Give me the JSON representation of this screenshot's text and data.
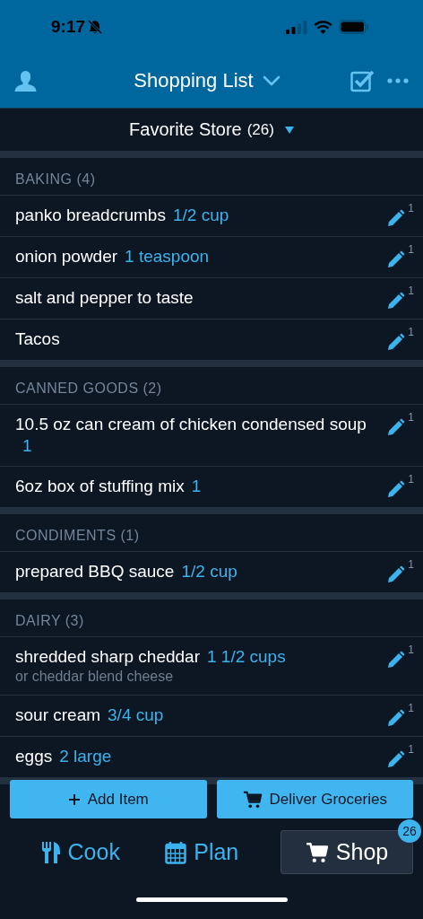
{
  "status_bar": {
    "time": "9:17"
  },
  "header": {
    "title": "Shopping List"
  },
  "store_bar": {
    "name": "Favorite Store",
    "count": "(26)"
  },
  "sections": [
    {
      "title": "BAKING (4)",
      "items": [
        {
          "name": "panko breadcrumbs",
          "amount": "1/2 cup",
          "count": "1"
        },
        {
          "name": "onion powder",
          "amount": "1 teaspoon",
          "count": "1"
        },
        {
          "name": "salt and pepper to taste",
          "count": "1"
        },
        {
          "name": "Tacos",
          "count": "1"
        }
      ]
    },
    {
      "title": "CANNED GOODS (2)",
      "items": [
        {
          "name": "10.5 oz can cream of chicken condensed soup",
          "amount": "1",
          "count": "1"
        },
        {
          "name": "6oz box of stuffing mix",
          "amount": "1",
          "count": "1"
        }
      ]
    },
    {
      "title": "CONDIMENTS (1)",
      "items": [
        {
          "name": "prepared BBQ sauce",
          "amount": "1/2 cup",
          "count": "1"
        }
      ]
    },
    {
      "title": "DAIRY (3)",
      "items": [
        {
          "name": "shredded sharp cheddar",
          "amount": "1 1/2 cups",
          "note": "or cheddar blend cheese",
          "count": "1"
        },
        {
          "name": "sour cream",
          "amount": "3/4 cup",
          "count": "1"
        },
        {
          "name": "eggs",
          "amount": "2 large",
          "count": "1"
        }
      ]
    }
  ],
  "actions": [
    {
      "kind": "add",
      "label": "Add Item"
    },
    {
      "kind": "deliver",
      "label": "Deliver Groceries"
    }
  ],
  "tabs": [
    {
      "kind": "cook",
      "label": "Cook",
      "selected": false
    },
    {
      "kind": "plan",
      "label": "Plan",
      "selected": false
    },
    {
      "kind": "shop",
      "label": "Shop",
      "selected": true,
      "badge": "26"
    }
  ]
}
